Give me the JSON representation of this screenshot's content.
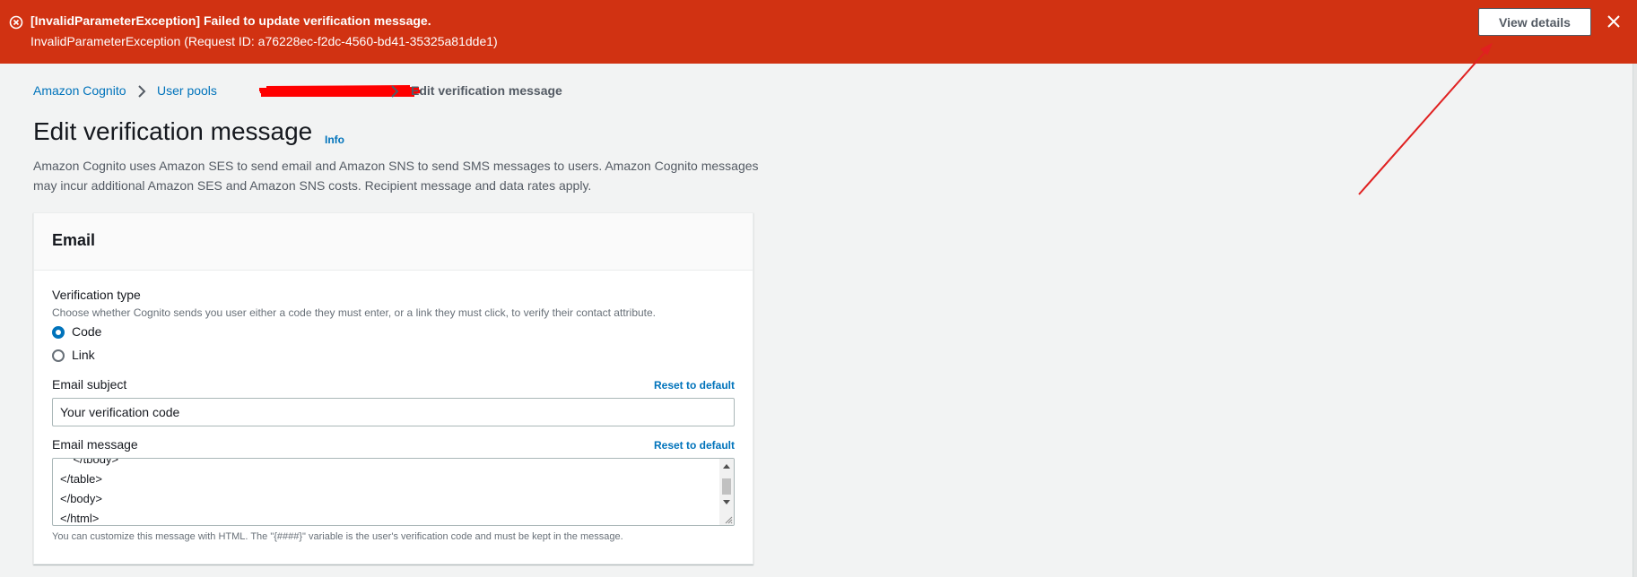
{
  "flash": {
    "title": "[InvalidParameterException] Failed to update verification message.",
    "message": "InvalidParameterException (Request ID: a76228ec-f2dc-4560-bd41-35325a81dde1)",
    "view_details_label": "View details",
    "color": "#d13212",
    "icon": "error-circle-icon"
  },
  "breadcrumb": {
    "items": [
      "Amazon Cognito",
      "User pools"
    ],
    "current": "Edit verification message"
  },
  "page": {
    "title": "Edit verification message",
    "info_label": "Info",
    "description": "Amazon Cognito uses Amazon SES to send email and Amazon SNS to send SMS messages to users. Amazon Cognito messages may incur additional Amazon SES and Amazon SNS costs. Recipient message and data rates apply."
  },
  "email_section": {
    "title": "Email",
    "verification_type": {
      "label": "Verification type",
      "description": "Choose whether Cognito sends you user either a code they must enter, or a link they must click, to verify their contact attribute.",
      "options": [
        {
          "label": "Code",
          "checked": true
        },
        {
          "label": "Link",
          "checked": false
        }
      ]
    },
    "subject": {
      "label": "Email subject",
      "reset_label": "Reset to default",
      "value": "Your verification code"
    },
    "message": {
      "label": "Email message",
      "reset_label": "Reset to default",
      "lines": [
        "    </tbody>",
        "</table>",
        "</body>",
        "</html>"
      ],
      "constraint": "You can customize this message with HTML. The \"{####}\" variable is the user's verification code and must be kept in the message."
    }
  },
  "colors": {
    "link": "#0073bb",
    "error": "#d13212",
    "annotation": "#e02020"
  }
}
